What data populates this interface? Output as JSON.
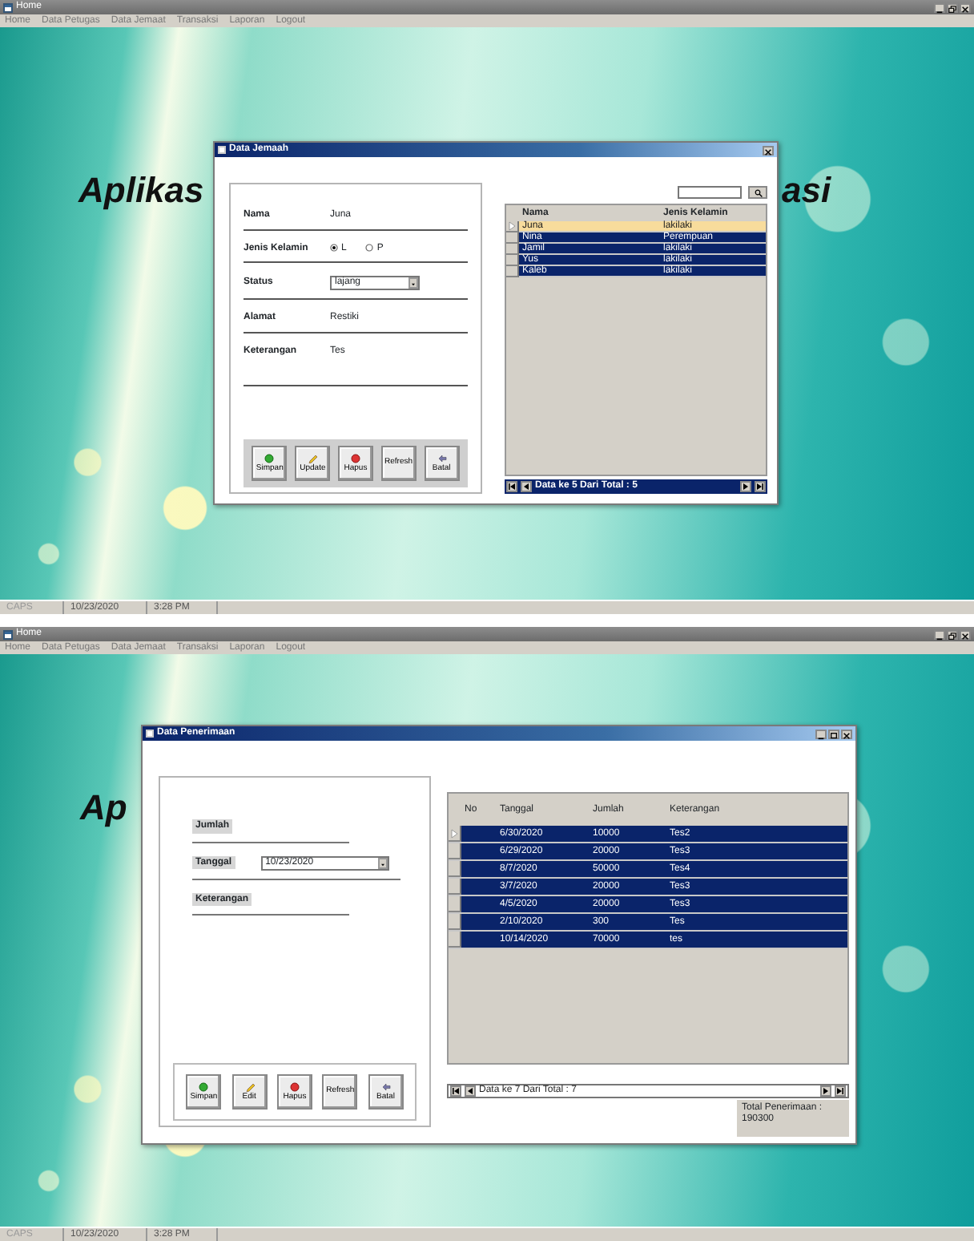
{
  "screens": [
    {
      "window": {
        "title": "Home"
      },
      "menu": [
        "Home",
        "Data Petugas",
        "Data Jemaat",
        "Transaksi",
        "Laporan",
        "Logout"
      ],
      "background_title": [
        "Aplikas",
        "asi"
      ],
      "dialog": {
        "kind": "jemaah",
        "title": "Data Jemaah",
        "form": [
          {
            "kind": "text",
            "label": "Nama",
            "value": "Juna"
          },
          {
            "kind": "radio",
            "label": "Jenis Kelamin",
            "options": [
              {
                "label": "L",
                "selected": true
              },
              {
                "label": "P",
                "selected": false
              }
            ]
          },
          {
            "kind": "combo",
            "label": "Status",
            "value": "lajang"
          },
          {
            "kind": "text",
            "label": "Alamat",
            "value": "Restiki"
          },
          {
            "kind": "note",
            "label": "Keterangan",
            "value": "Tes"
          }
        ],
        "actions": [
          {
            "kind": "save",
            "label": "Simpan"
          },
          {
            "kind": "edit",
            "label": "Update"
          },
          {
            "kind": "delete",
            "label": "Hapus"
          },
          {
            "kind": "refresh",
            "label": "Refresh"
          },
          {
            "kind": "cancel",
            "label": "Batal"
          }
        ],
        "grid": {
          "columns": [
            {
              "label": "Nama"
            },
            {
              "label": "Jenis Kelamin"
            }
          ],
          "rows": [
            {
              "cells": [
                "Juna",
                "lakilaki"
              ],
              "selected": false,
              "current": true
            },
            {
              "cells": [
                "Nina",
                "Perempuan"
              ],
              "selected": true,
              "current": false
            },
            {
              "cells": [
                "Jamil",
                "lakilaki"
              ],
              "selected": true,
              "current": false
            },
            {
              "cells": [
                "Yus",
                "lakilaki"
              ],
              "selected": true,
              "current": false
            },
            {
              "cells": [
                "Kaleb",
                "lakilaki"
              ],
              "selected": true,
              "current": false
            }
          ],
          "navigator": "Data ke 5 Dari Total : 5"
        }
      },
      "status_bar": [
        "CAPS",
        "10/23/2020",
        "3:28 PM"
      ]
    },
    {
      "window": {
        "title": "Home"
      },
      "menu": [
        "Home",
        "Data Petugas",
        "Data Jemaat",
        "Transaksi",
        "Laporan",
        "Logout"
      ],
      "background_title": [
        "Ap"
      ],
      "dialog": {
        "kind": "penerimaan",
        "title": "Data Penerimaan",
        "shaded_labels": true,
        "form": [
          {
            "kind": "heading",
            "label": "Jumlah"
          },
          {
            "kind": "combo",
            "label": "Tanggal",
            "value": "10/23/2020"
          },
          {
            "kind": "heading",
            "label": "Keterangan"
          }
        ],
        "actions": [
          {
            "kind": "save",
            "label": "Simpan"
          },
          {
            "kind": "edit",
            "label": "Edit"
          },
          {
            "kind": "delete",
            "label": "Hapus"
          },
          {
            "kind": "refresh",
            "label": "Refresh"
          },
          {
            "kind": "cancel",
            "label": "Batal"
          }
        ],
        "grid": {
          "columns": [
            {
              "label": "No"
            },
            {
              "label": "Tanggal"
            },
            {
              "label": "Jumlah"
            },
            {
              "label": "Keterangan"
            }
          ],
          "rows": [
            {
              "cells": [
                "",
                "6/30/2020",
                "10000",
                "Tes2"
              ],
              "selected": true,
              "current": true
            },
            {
              "cells": [
                "",
                "6/29/2020",
                "20000",
                "Tes3"
              ],
              "selected": true,
              "current": false
            },
            {
              "cells": [
                "",
                "8/7/2020",
                "50000",
                "Tes4"
              ],
              "selected": true,
              "current": false
            },
            {
              "cells": [
                "",
                "3/7/2020",
                "20000",
                "Tes3"
              ],
              "selected": true,
              "current": false
            },
            {
              "cells": [
                "",
                "4/5/2020",
                "20000",
                "Tes3"
              ],
              "selected": true,
              "current": false
            },
            {
              "cells": [
                "",
                "2/10/2020",
                "300",
                "Tes"
              ],
              "selected": true,
              "current": false
            },
            {
              "cells": [
                "",
                "10/14/2020",
                "70000",
                "tes"
              ],
              "selected": true,
              "current": false
            }
          ],
          "navigator": "Data ke 7 Dari Total : 7"
        },
        "total": "Total Penerimaan : 190300"
      },
      "status_bar": [
        "CAPS",
        "10/23/2020",
        "3:28 PM"
      ]
    }
  ]
}
